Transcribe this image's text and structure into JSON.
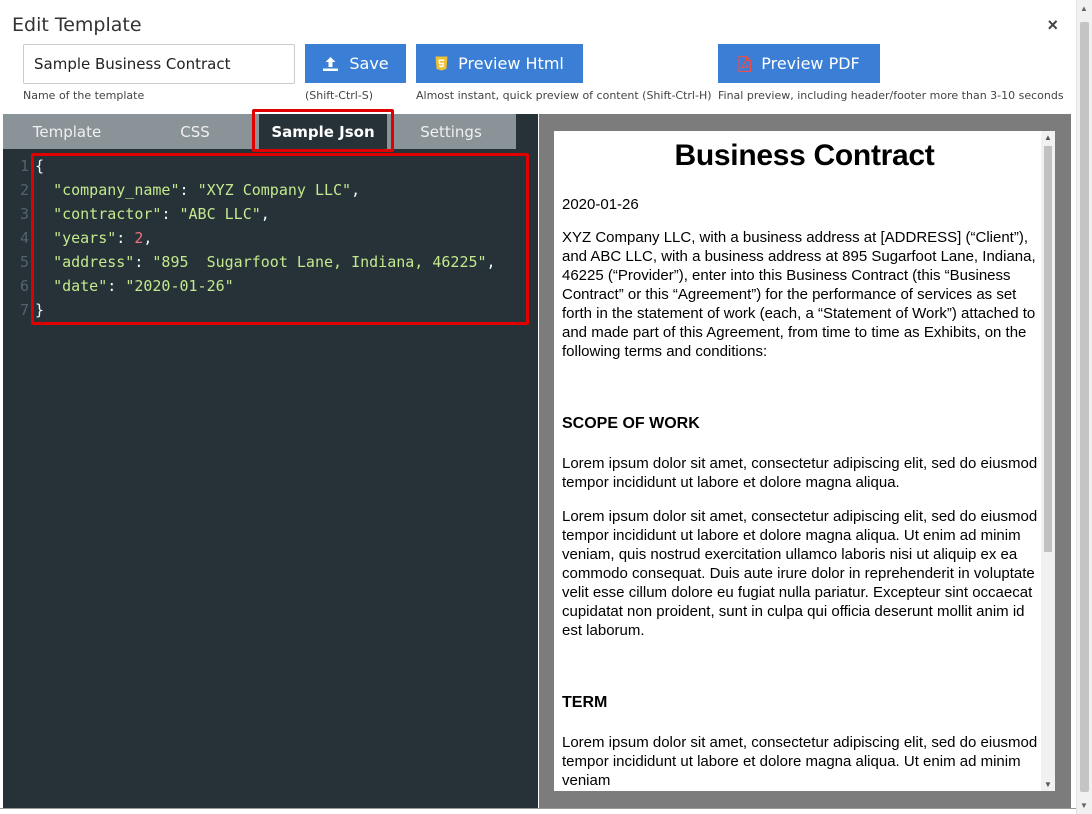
{
  "dialog": {
    "title": "Edit Template",
    "close_icon": "close-icon",
    "close_symbol": "×"
  },
  "template_name": {
    "value": "Sample Business Contract",
    "hint": "Name of the template"
  },
  "buttons": {
    "save": {
      "label": "Save",
      "hint": "(Shift-Ctrl-S)",
      "icon": "upload-icon"
    },
    "preview_html": {
      "label": "Preview Html",
      "hint": "Almost instant, quick preview of content (Shift-Ctrl-H)",
      "icon": "html5-icon"
    },
    "preview_pdf": {
      "label": "Preview PDF",
      "hint": "Final preview, including header/footer more than 3-10 seconds",
      "icon": "pdf-file-icon"
    },
    "color": "#3a7fd5"
  },
  "tabs": [
    {
      "label": "Template",
      "active": false
    },
    {
      "label": "CSS",
      "active": false
    },
    {
      "label": "Sample Json",
      "active": true
    },
    {
      "label": "Settings",
      "active": false
    }
  ],
  "sample_json": {
    "line_numbers": [
      "1",
      "2",
      "3",
      "4",
      "5",
      "6",
      "7"
    ],
    "open_brace": "{",
    "close_brace": "}",
    "entries": [
      {
        "key": "\"company_name\"",
        "value": "\"XYZ Company LLC\"",
        "comma": ","
      },
      {
        "key": "\"contractor\"",
        "value": "\"ABC LLC\"",
        "comma": ","
      },
      {
        "key": "\"years\"",
        "value": "2",
        "comma": ","
      },
      {
        "key": "\"address\"",
        "value": "\"895  Sugarfoot Lane, Indiana, 46225\"",
        "comma": ","
      },
      {
        "key": "\"date\"",
        "value": "\"2020-01-26\"",
        "comma": ""
      }
    ],
    "highlight_color": "#e00000"
  },
  "preview": {
    "title": "Business Contract",
    "date": "2020-01-26",
    "intro": "XYZ Company LLC, with a business address at [ADDRESS] (“Client”), and ABC LLC, with a business address at 895 Sugarfoot Lane, Indiana, 46225 (“Provider”), enter into this Business Contract (this “Business Contract” or this “Agreement”) for the performance of services as set forth in the statement of work (each, a “Statement of Work”) attached to and made part of this Agreement, from time to time as Exhibits, on the following terms and conditions:",
    "scope_heading": "SCOPE OF WORK",
    "scope_p1": "Lorem ipsum dolor sit amet, consectetur adipiscing elit, sed do eiusmod tempor incididunt ut labore et dolore magna aliqua.",
    "scope_p2": "Lorem ipsum dolor sit amet, consectetur adipiscing elit, sed do eiusmod tempor incididunt ut labore et dolore magna aliqua. Ut enim ad minim veniam, quis nostrud exercitation ullamco laboris nisi ut aliquip ex ea commodo consequat. Duis aute irure dolor in reprehenderit in voluptate velit esse cillum dolore eu fugiat nulla pariatur. Excepteur sint occaecat cupidatat non proident, sunt in culpa qui officia deserunt mollit anim id est laborum.",
    "term_heading": "TERM",
    "term_p1": "Lorem ipsum dolor sit amet, consectetur adipiscing elit, sed do eiusmod tempor incididunt ut labore et dolore magna aliqua. Ut enim ad minim veniam"
  }
}
